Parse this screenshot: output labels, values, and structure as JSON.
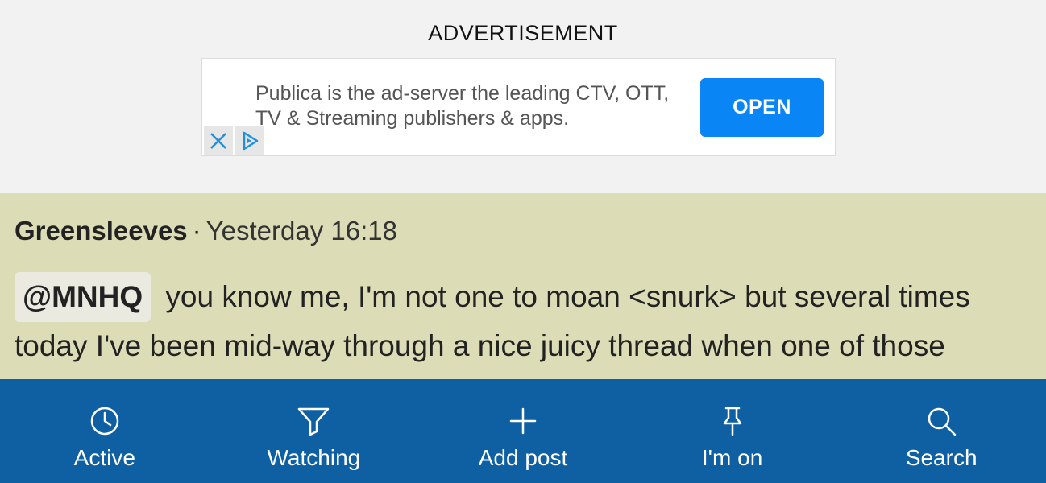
{
  "advertisement": {
    "label": "ADVERTISEMENT",
    "text": "Publica is the ad-server the leading CTV, OTT, TV & Streaming publishers & apps.",
    "button_label": "OPEN",
    "close_icon": "close-icon",
    "adchoices_icon": "adchoices-icon",
    "button_color": "#0a85f5"
  },
  "post": {
    "author": "Greensleeves",
    "separator": "·",
    "timestamp": "Yesterday 16:18",
    "mention": "@MNHQ",
    "body": "you know me, I'm not one to moan <snurk> but several times today I've been mid-way through a nice juicy thread when one of those",
    "background_color": "#dcdcb6"
  },
  "bottom_nav": {
    "background_color": "#0e60a3",
    "items": [
      {
        "label": "Active",
        "icon": "clock-icon"
      },
      {
        "label": "Watching",
        "icon": "filter-icon"
      },
      {
        "label": "Add post",
        "icon": "plus-icon"
      },
      {
        "label": "I'm on",
        "icon": "pin-icon"
      },
      {
        "label": "Search",
        "icon": "search-icon"
      }
    ]
  }
}
